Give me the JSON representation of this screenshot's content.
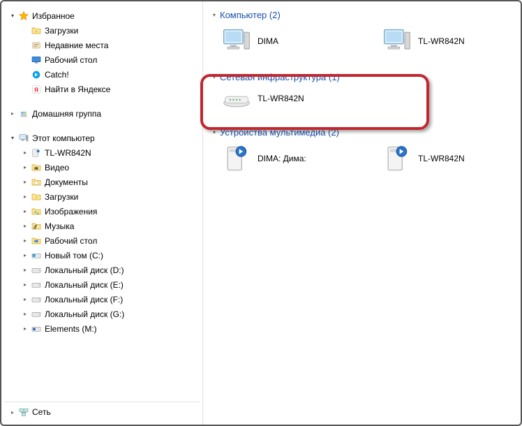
{
  "sidebar": {
    "favorites": {
      "label": "Избранное",
      "items": [
        {
          "label": "Загрузки"
        },
        {
          "label": "Недавние места"
        },
        {
          "label": "Рабочий стол"
        },
        {
          "label": "Catch!"
        },
        {
          "label": "Найти в Яндексе"
        }
      ]
    },
    "homegroup": {
      "label": "Домашняя группа"
    },
    "thispc": {
      "label": "Этот компьютер",
      "items": [
        {
          "label": "TL-WR842N"
        },
        {
          "label": "Видео"
        },
        {
          "label": "Документы"
        },
        {
          "label": "Загрузки"
        },
        {
          "label": "Изображения"
        },
        {
          "label": "Музыка"
        },
        {
          "label": "Рабочий стол"
        },
        {
          "label": "Новый том (C:)"
        },
        {
          "label": "Локальный диск (D:)"
        },
        {
          "label": "Локальный диск (E:)"
        },
        {
          "label": "Локальный диск (F:)"
        },
        {
          "label": "Локальный диск (G:)"
        },
        {
          "label": "Elements (M:)"
        }
      ]
    },
    "network": {
      "label": "Сеть"
    }
  },
  "main": {
    "sections": [
      {
        "title": "Компьютер (2)",
        "items": [
          {
            "label": "DIMA"
          },
          {
            "label": "TL-WR842N"
          }
        ]
      },
      {
        "title": "Сетевая инфраструктура (1)",
        "items": [
          {
            "label": "TL-WR842N"
          }
        ]
      },
      {
        "title": "Устройства мультимедиа (2)",
        "items": [
          {
            "label": "DIMA: Дима:"
          },
          {
            "label": "TL-WR842N"
          }
        ]
      }
    ]
  }
}
